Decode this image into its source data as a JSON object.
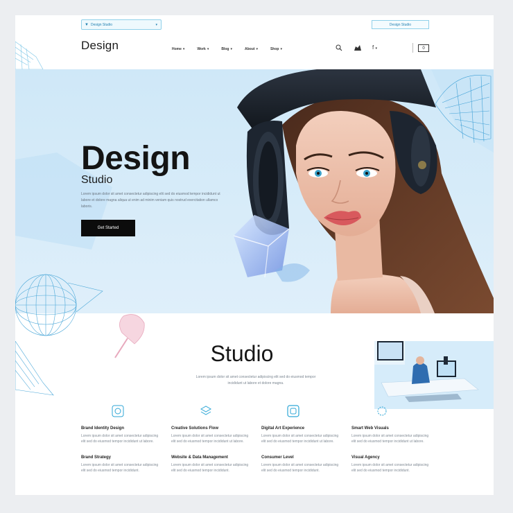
{
  "topbar": {
    "search_text": "Design Studio",
    "cta_label": "Design Studio"
  },
  "header": {
    "brand": "Design",
    "nav": [
      "Home",
      "Work",
      "Blog",
      "About",
      "Shop"
    ],
    "box_label": "0"
  },
  "hero": {
    "title": "Design",
    "subtitle": "Studio",
    "body": "Lorem ipsum dolor sit amet consectetur adipiscing elit sed do eiusmod tempor incididunt ut labore et dolore magna aliqua ut enim ad minim veniam quis nostrud exercitation ullamco laboris.",
    "button_label": "Get Started"
  },
  "studio": {
    "title": "Studio",
    "body": "Lorem ipsum dolor sit amet consectetur adipiscing elit sed do eiusmod tempor incididunt ut labore et dolore magna."
  },
  "features": [
    {
      "title": "Brand Identity Design",
      "desc": "Lorem ipsum dolor sit amet consectetur adipiscing elit sed do eiusmod tempor incididunt ut labore."
    },
    {
      "title": "Creative Solutions Flow",
      "desc": "Lorem ipsum dolor sit amet consectetur adipiscing elit sed do eiusmod tempor incididunt ut labore."
    },
    {
      "title": "Digital Art Experience",
      "desc": "Lorem ipsum dolor sit amet consectetur adipiscing elit sed do eiusmod tempor incididunt ut labore."
    },
    {
      "title": "Smart Web Visuals",
      "desc": "Lorem ipsum dolor sit amet consectetur adipiscing elit sed do eiusmod tempor incididunt ut labore."
    },
    {
      "title": "Brand Strategy",
      "desc": "Lorem ipsum dolor sit amet consectetur adipiscing elit sed do eiusmod tempor incididunt."
    },
    {
      "title": "Website & Data Management",
      "desc": "Lorem ipsum dolor sit amet consectetur adipiscing elit sed do eiusmod tempor incididunt."
    },
    {
      "title": "Consumer Level",
      "desc": "Lorem ipsum dolor sit amet consectetur adipiscing elit sed do eiusmod tempor incididunt."
    },
    {
      "title": "Visual Agency",
      "desc": "Lorem ipsum dolor sit amet consectetur adipiscing elit sed do eiusmod tempor incididunt."
    }
  ],
  "colors": {
    "accent": "#8fd0ea",
    "hero_bg": "#d3e9f8",
    "button_bg": "#0c0c0c",
    "text_dark": "#141414"
  },
  "icons": [
    "search-icon",
    "user-icon",
    "facebook-icon",
    "social-icon",
    "brand-icon",
    "layers-icon",
    "box-icon"
  ]
}
